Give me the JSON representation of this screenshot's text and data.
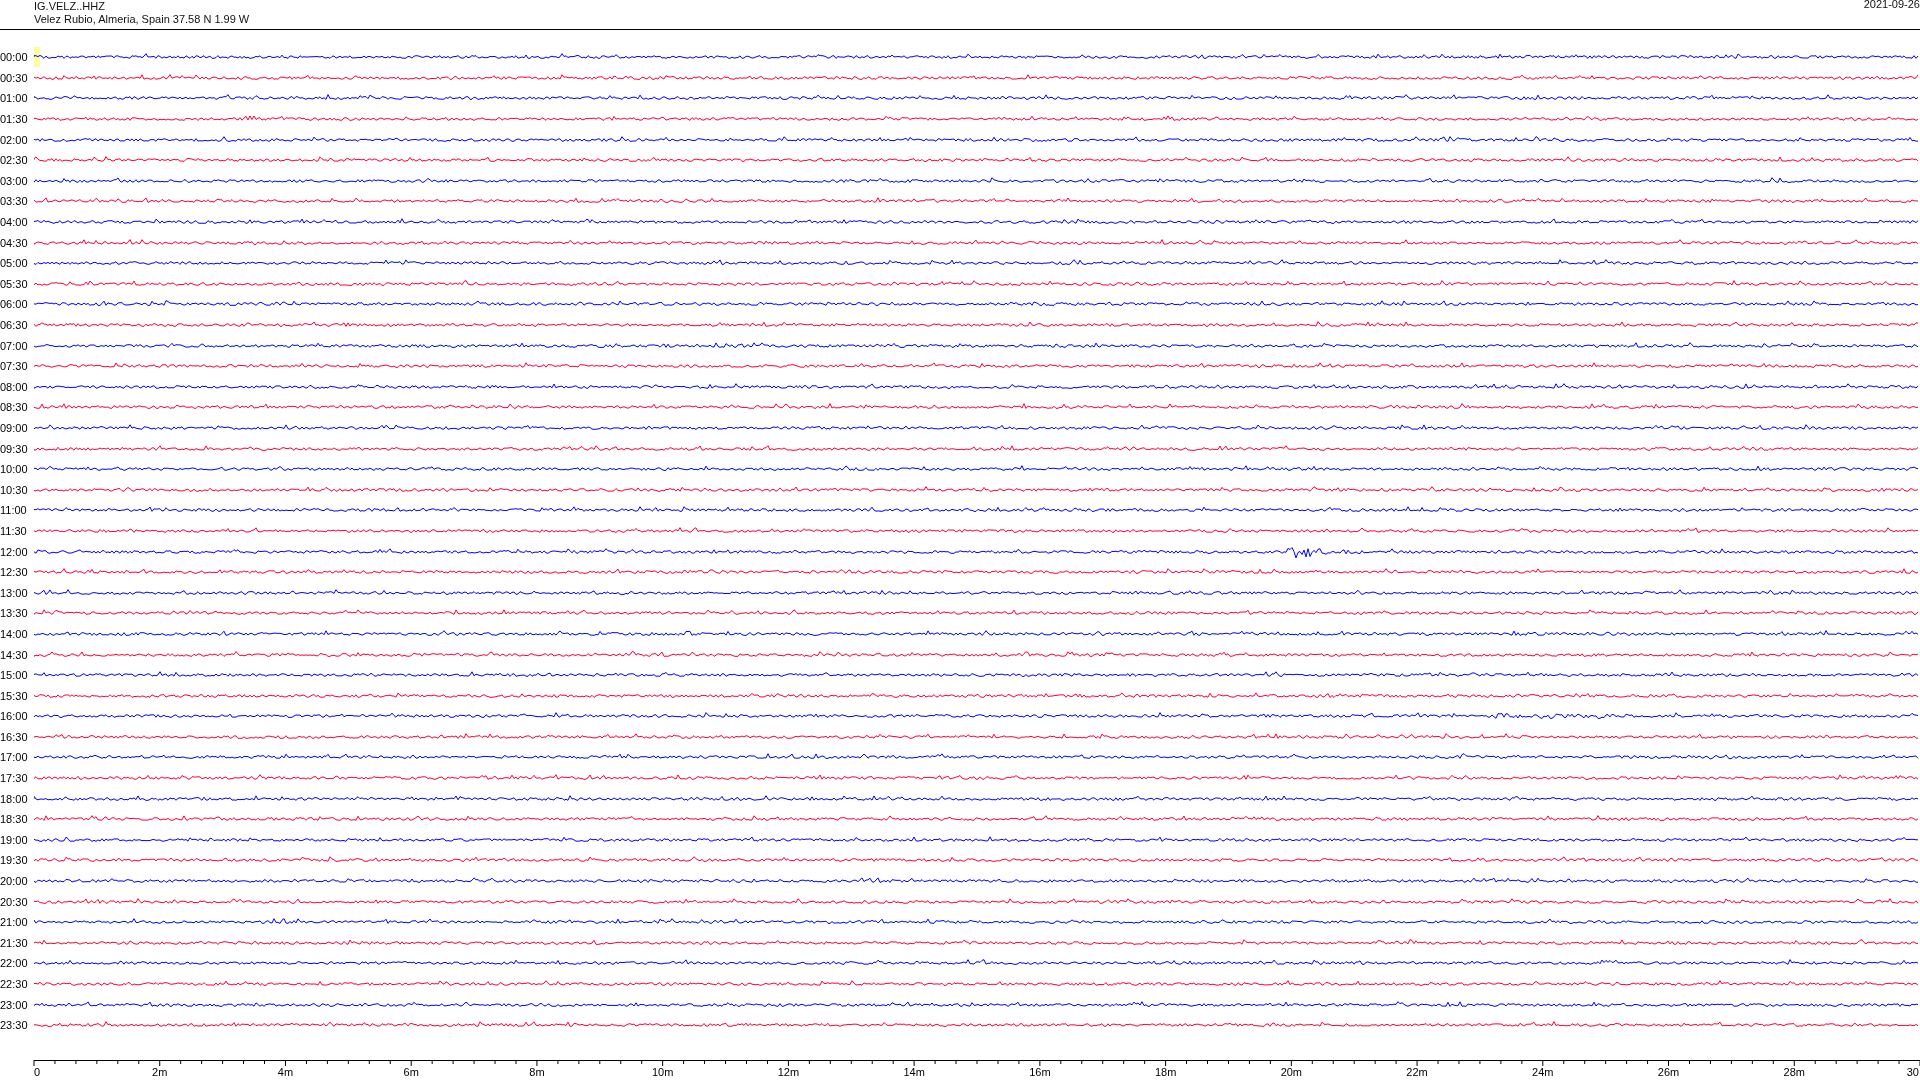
{
  "header": {
    "station": "IG.VELZ..HHZ",
    "location": "Velez Rubio, Almeria, Spain  37.58 N 1.99 W",
    "date": "2021-09-26"
  },
  "rows": [
    {
      "time": "00:00",
      "color": "#0000ff",
      "marked": true
    },
    {
      "time": "00:30",
      "color": "#ff0033",
      "marked": false
    },
    {
      "time": "01:00",
      "color": "#0000ff",
      "marked": false
    },
    {
      "time": "01:30",
      "color": "#ff0033",
      "marked": false
    },
    {
      "time": "02:00",
      "color": "#0000ff",
      "marked": false
    },
    {
      "time": "02:30",
      "color": "#ff0033",
      "marked": false
    },
    {
      "time": "03:00",
      "color": "#0000ff",
      "marked": false
    },
    {
      "time": "03:30",
      "color": "#ff0033",
      "marked": false
    },
    {
      "time": "04:00",
      "color": "#0000ff",
      "marked": false
    },
    {
      "time": "04:30",
      "color": "#ff0033",
      "marked": false
    },
    {
      "time": "05:00",
      "color": "#0000ff",
      "marked": false
    },
    {
      "time": "05:30",
      "color": "#ff0033",
      "marked": false
    },
    {
      "time": "06:00",
      "color": "#0000ff",
      "marked": false
    },
    {
      "time": "06:30",
      "color": "#ff0033",
      "marked": false
    },
    {
      "time": "07:00",
      "color": "#0000ff",
      "marked": false
    },
    {
      "time": "07:30",
      "color": "#ff0033",
      "marked": false
    },
    {
      "time": "08:00",
      "color": "#0000ff",
      "marked": false
    },
    {
      "time": "08:30",
      "color": "#ff0033",
      "marked": false
    },
    {
      "time": "09:00",
      "color": "#0000ff",
      "marked": false
    },
    {
      "time": "09:30",
      "color": "#ff0033",
      "marked": false
    },
    {
      "time": "10:00",
      "color": "#0000ff",
      "marked": false
    },
    {
      "time": "10:30",
      "color": "#ff0033",
      "marked": false
    },
    {
      "time": "11:00",
      "color": "#0000ff",
      "marked": false
    },
    {
      "time": "11:30",
      "color": "#ff0033",
      "marked": false
    },
    {
      "time": "12:00",
      "color": "#0000ff",
      "marked": false
    },
    {
      "time": "12:30",
      "color": "#ff0033",
      "marked": false
    },
    {
      "time": "13:00",
      "color": "#0000ff",
      "marked": false
    },
    {
      "time": "13:30",
      "color": "#ff0033",
      "marked": false
    },
    {
      "time": "14:00",
      "color": "#0000ff",
      "marked": false
    },
    {
      "time": "14:30",
      "color": "#ff0033",
      "marked": false
    },
    {
      "time": "15:00",
      "color": "#0000ff",
      "marked": false
    },
    {
      "time": "15:30",
      "color": "#ff0033",
      "marked": false
    },
    {
      "time": "16:00",
      "color": "#0000ff",
      "marked": false
    },
    {
      "time": "16:30",
      "color": "#ff0033",
      "marked": false
    },
    {
      "time": "17:00",
      "color": "#0000ff",
      "marked": false
    },
    {
      "time": "17:30",
      "color": "#ff0033",
      "marked": false
    },
    {
      "time": "18:00",
      "color": "#0000ff",
      "marked": false
    },
    {
      "time": "18:30",
      "color": "#ff0033",
      "marked": false
    },
    {
      "time": "19:00",
      "color": "#0000ff",
      "marked": false
    },
    {
      "time": "19:30",
      "color": "#ff0033",
      "marked": false
    },
    {
      "time": "20:00",
      "color": "#0000ff",
      "marked": false
    },
    {
      "time": "20:30",
      "color": "#ff0033",
      "marked": false
    },
    {
      "time": "21:00",
      "color": "#0000ff",
      "marked": false
    },
    {
      "time": "21:30",
      "color": "#ff0033",
      "marked": false
    },
    {
      "time": "22:00",
      "color": "#0000ff",
      "marked": false
    },
    {
      "time": "22:30",
      "color": "#ff0033",
      "marked": false
    },
    {
      "time": "23:00",
      "color": "#0000ff",
      "marked": false
    },
    {
      "time": "23:30",
      "color": "#ff0033",
      "marked": false
    }
  ],
  "axis": {
    "ticks": [
      "0",
      "2m",
      "4m",
      "6m",
      "8m",
      "10m",
      "12m",
      "14m",
      "16m",
      "18m",
      "20m",
      "22m",
      "24m",
      "26m",
      "28m",
      "30"
    ]
  }
}
